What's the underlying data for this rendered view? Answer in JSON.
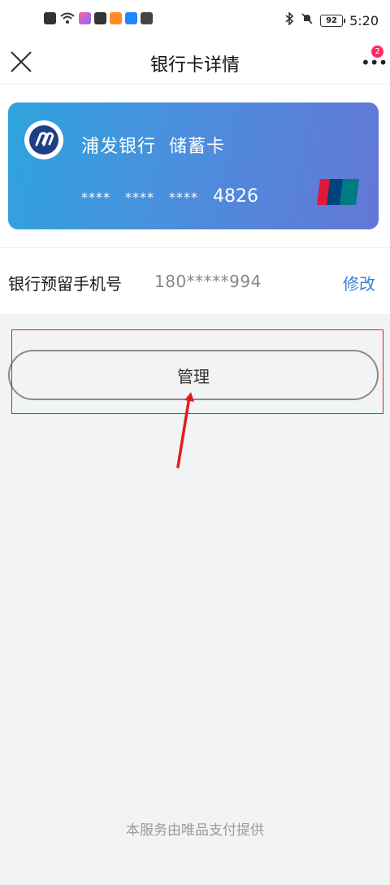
{
  "status_bar": {
    "time": "5:20",
    "battery": "92"
  },
  "header": {
    "title": "银行卡详情",
    "badge_count": "2"
  },
  "card": {
    "bank_name": "浦发银行",
    "card_type": "储蓄卡",
    "mask_groups": [
      "****",
      "****",
      "****"
    ],
    "last_four": "4826",
    "network_logo_text": "UnionPay",
    "network_logo_cn": "银联",
    "gradient_start": "#2fa3de",
    "gradient_end": "#6377d6"
  },
  "phone": {
    "label": "银行预留手机号",
    "value": "180*****994",
    "edit_label": "修改"
  },
  "manage": {
    "label": "管理"
  },
  "footer": {
    "text": "本服务由唯品支付提供"
  },
  "colors": {
    "accent": "#3b82d6",
    "badge": "#ff2a5e",
    "annotation": "#e21d1d"
  }
}
